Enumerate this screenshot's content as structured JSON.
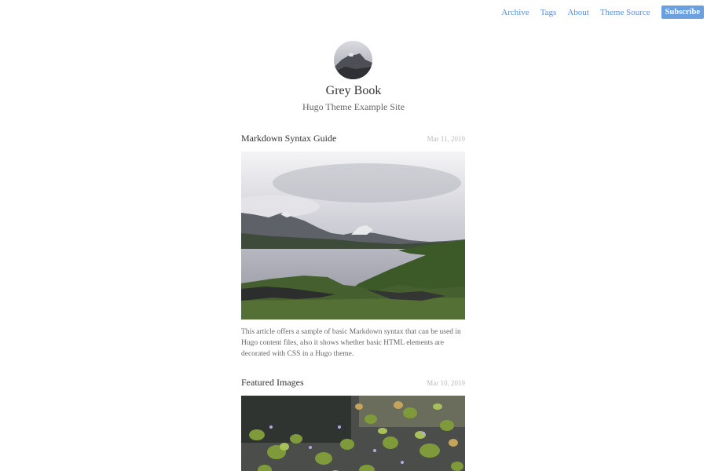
{
  "nav": {
    "links": [
      "Archive",
      "Tags",
      "About",
      "Theme Source"
    ],
    "subscribe_label": "Subscribe",
    "link_color": "#5b8fd6",
    "button_color": "#6a9fe0"
  },
  "site": {
    "title": "Grey Book",
    "subtitle": "Hugo Theme Example Site"
  },
  "posts": [
    {
      "title": "Markdown Syntax Guide",
      "date": "Mar 11, 2019",
      "excerpt": "This article offers a sample of basic Markdown syntax that can be used in Hugo content files, also it shows whether basic HTML elements are decorated with CSS in a Hugo theme."
    },
    {
      "title": "Featured Images",
      "date": "Mar 10, 2019",
      "excerpt": ""
    }
  ]
}
